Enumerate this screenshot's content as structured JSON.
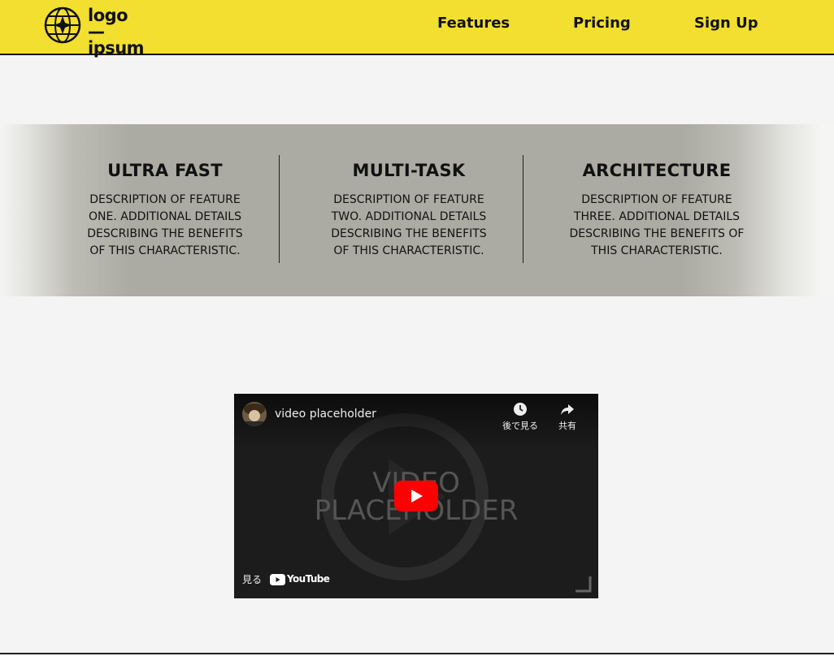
{
  "brand": {
    "logo_line1": "logo",
    "logo_line2": "ipsum"
  },
  "nav": {
    "features": "Features",
    "pricing": "Pricing",
    "signup": "Sign Up"
  },
  "features": [
    {
      "title": "ULTRA FAST",
      "desc": [
        "DESCRIPTION OF FEATURE",
        "ONE. ADDITIONAL DETAILS",
        "DESCRIBING THE BENEFITS",
        "OF THIS CHARACTERISTIC."
      ]
    },
    {
      "title": "MULTI-TASK",
      "desc": [
        "DESCRIPTION OF FEATURE",
        "TWO. ADDITIONAL DETAILS",
        "DESCRIBING THE BENEFITS",
        "OF THIS CHARACTERISTIC."
      ]
    },
    {
      "title": "ARCHITECTURE",
      "desc": [
        "DESCRIPTION OF FEATURE",
        "THREE. ADDITIONAL DETAILS",
        "DESCRIBING THE BENEFITS OF",
        "THIS CHARACTERISTIC."
      ]
    }
  ],
  "video": {
    "title": "video placeholder",
    "placeholder_line1": "VIDEO",
    "placeholder_line2": "PLACEHOLDER",
    "watch_later": "後で見る",
    "share": "共有",
    "watch_on": "見る",
    "youtube": "YouTube"
  },
  "colors": {
    "header_bg": "#f3df2f",
    "band": "#acaba3",
    "play_red": "#ff0000"
  }
}
